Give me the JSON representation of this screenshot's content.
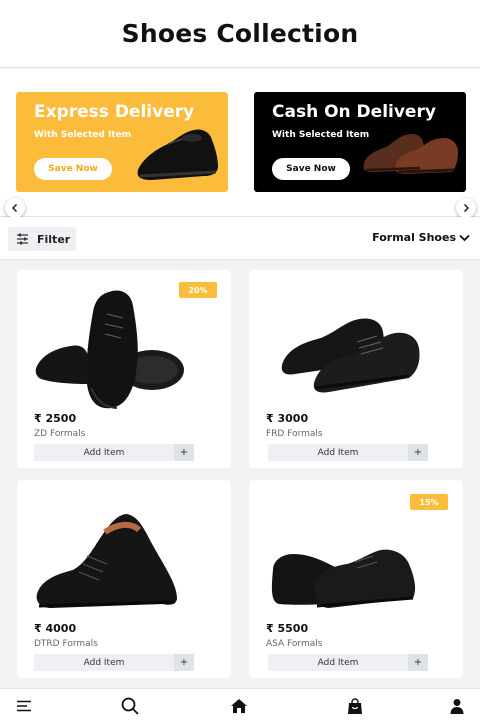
{
  "header": {
    "title": "Shoes Collection"
  },
  "banners": [
    {
      "title": "Express Delivery",
      "subtitle": "With Selected Item",
      "button": "Save Now",
      "bg": "#fcbc3b"
    },
    {
      "title": "Cash On Delivery",
      "subtitle": "With Selected Item",
      "button": "Save Now",
      "bg": "#000000"
    }
  ],
  "carousel": {
    "prev_icon": "chevron-left-icon",
    "next_icon": "chevron-right-icon"
  },
  "filterbar": {
    "filter_label": "Filter",
    "sort_label": "Formal Shoes"
  },
  "products": [
    {
      "price": "₹ 2500",
      "brand": "ZD Formals",
      "add_label": "Add Item",
      "plus": "+",
      "badge": "20%"
    },
    {
      "price": "₹ 3000",
      "brand": "FRD Formals",
      "add_label": "Add Item",
      "plus": "+",
      "badge": ""
    },
    {
      "price": "₹ 4000",
      "brand": "DTRD Formals",
      "add_label": "Add Item",
      "plus": "+",
      "badge": ""
    },
    {
      "price": "₹ 5500",
      "brand": "ASA Formals",
      "add_label": "Add Item",
      "plus": "+",
      "badge": "15%"
    }
  ],
  "bottom_nav": [
    "menu-icon",
    "search-icon",
    "home-icon",
    "bag-icon",
    "user-icon"
  ],
  "colors": {
    "accent": "#fcbc3b",
    "background": "#f1f2f4",
    "dark": "#000000"
  }
}
